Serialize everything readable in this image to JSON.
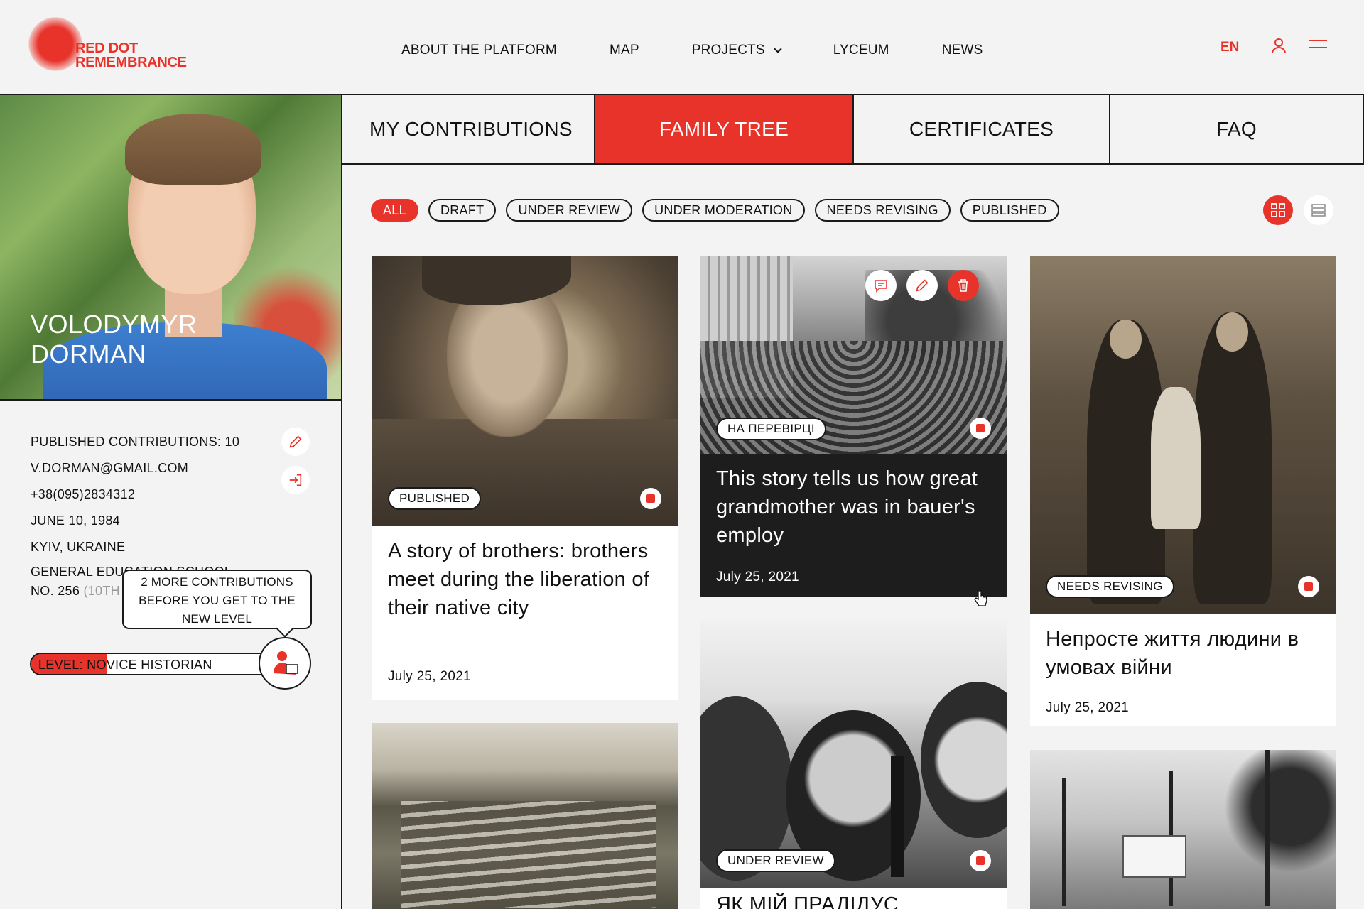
{
  "header": {
    "logo_line1": "RED DOT",
    "logo_line2": "REMEMBRANCE",
    "nav": [
      "ABOUT THE PLATFORM",
      "MAP",
      "PROJECTS",
      "LYCEUM",
      "NEWS"
    ],
    "lang": "EN",
    "icons": {
      "user": "user-icon",
      "menu": "menu-icon"
    }
  },
  "profile": {
    "first_name": "VOLODYMYR",
    "last_name": "DORMAN",
    "published_contributions": "PUBLISHED CONTRIBUTIONS: 10",
    "email": "V.DORMAN@GMAIL.COM",
    "phone": "+38(095)2834312",
    "birth_date": "JUNE 10, 1984",
    "city": "KYIV, UKRAINE",
    "school_line1": "GENERAL EDUCATION SCHOOL",
    "school_line2": "NO. 256",
    "school_grade": "(10TH",
    "tooltip": "2 MORE CONTRIBUTIONS BEFORE YOU GET TO THE NEW LEVEL",
    "level": "LEVEL: NOVICE HISTORIAN",
    "level_progress": 0.31
  },
  "tabs": [
    "MY CONTRIBUTIONS",
    "FAMILY TREE",
    "CERTIFICATES",
    "FAQ"
  ],
  "active_tab": 1,
  "filters": [
    "ALL",
    "DRAFT",
    "UNDER REVIEW",
    "UNDER MODERATION",
    "NEEDS REVISING",
    "PUBLISHED"
  ],
  "active_filter": 0,
  "cards": [
    {
      "badge": "PUBLISHED",
      "title": "A story of brothers: brothers meet during the liberation of their native city",
      "date": "July 25, 2021"
    },
    {
      "badge": "НА ПЕРЕВІРЦІ",
      "title": "This story tells us how great grandmother was in bauer's employ",
      "date": "July 25, 2021"
    },
    {
      "badge": "NEEDS REVISING",
      "title": "Непросте життя людини в умовах війни",
      "date": "July 25, 2021"
    },
    {
      "badge": "UNDER REVIEW",
      "title": "ЯК МІЙ ПРАДІДУС"
    }
  ],
  "colors": {
    "accent": "#e8332a",
    "background": "#f3f3f3",
    "dark_card": "#1d1d1d"
  }
}
